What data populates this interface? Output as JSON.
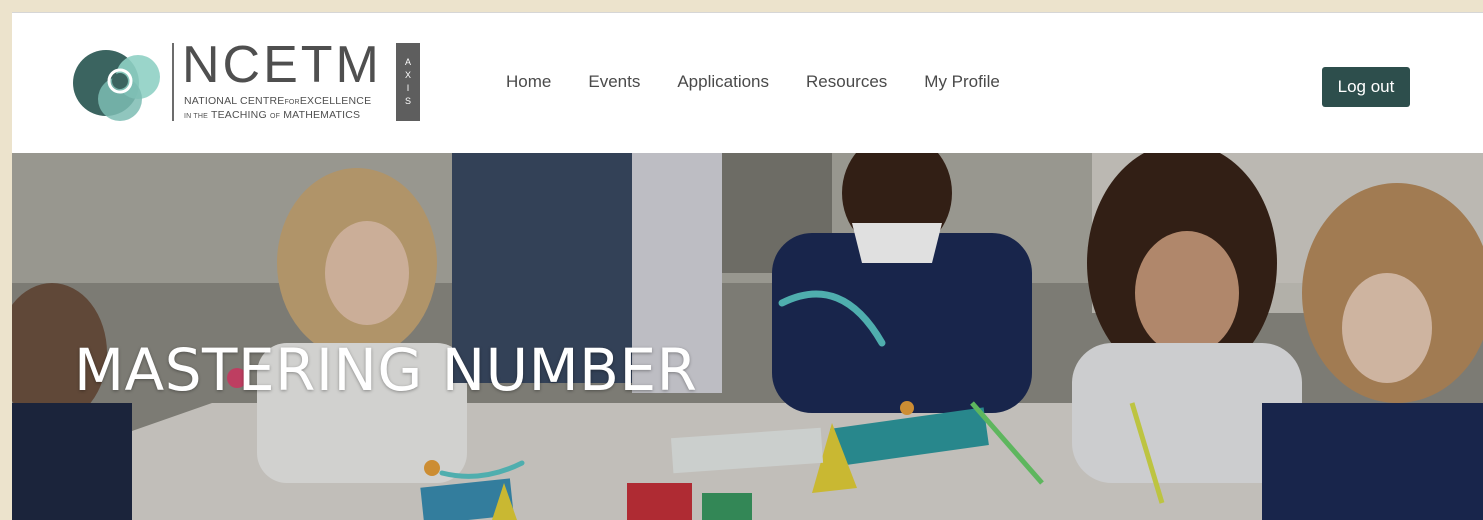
{
  "logo": {
    "wordmark": "NCETM",
    "subline1_a": "NATIONAL CENTRE",
    "subline1_small": "FOR",
    "subline1_b": "EXCELLENCE",
    "subline2_small1": "IN THE",
    "subline2_a": "TEACHING",
    "subline2_small2": "OF",
    "subline2_b": "MATHEMATICS",
    "badge_letters": [
      "A",
      "X",
      "I",
      "S"
    ]
  },
  "nav": {
    "items": [
      {
        "label": "Home"
      },
      {
        "label": "Events"
      },
      {
        "label": "Applications"
      },
      {
        "label": "Resources"
      },
      {
        "label": "My Profile"
      }
    ]
  },
  "header": {
    "logout_label": "Log out"
  },
  "hero": {
    "title": "MASTERING NUMBER"
  },
  "colors": {
    "accent": "#2d4e4c",
    "page_bg": "#ece3cc",
    "logo_teal_dark": "#3b6460",
    "logo_teal_light": "#7cbcb3"
  }
}
